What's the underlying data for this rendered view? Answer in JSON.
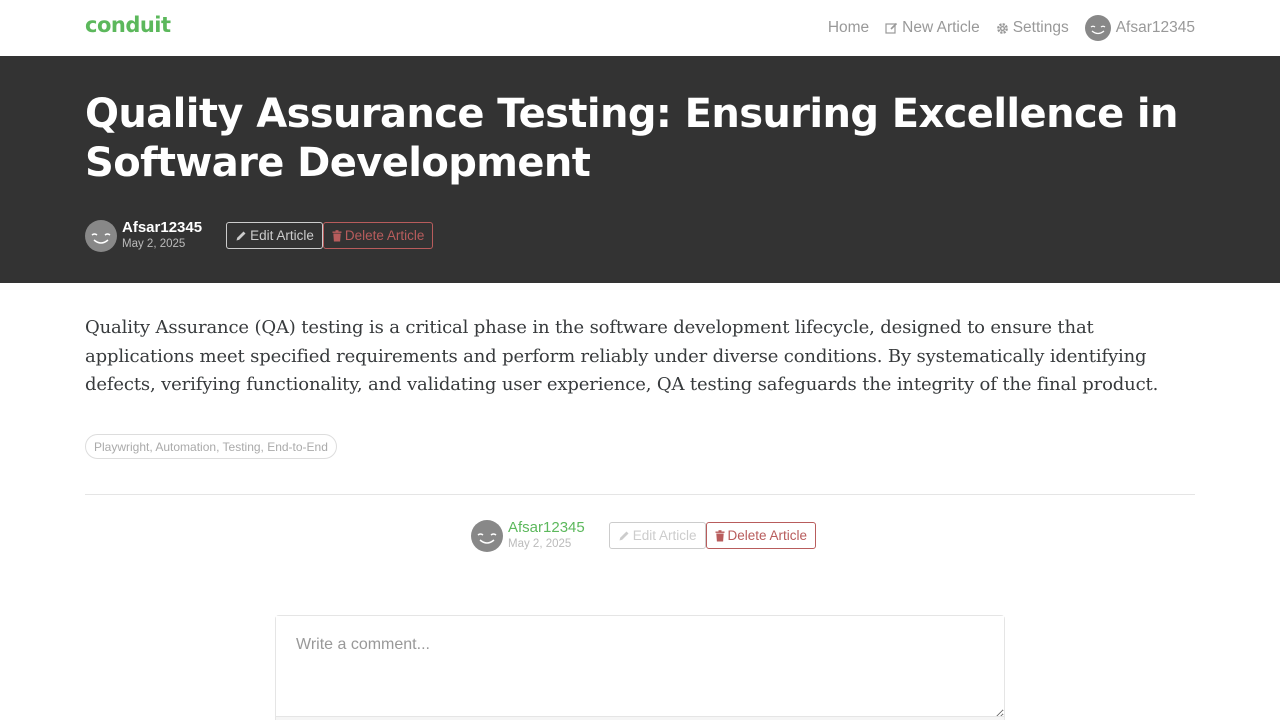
{
  "navbar": {
    "brand": "conduit",
    "items": [
      {
        "label": "Home",
        "icon": null
      },
      {
        "label": "New Article",
        "icon": "edit-icon"
      },
      {
        "label": "Settings",
        "icon": "gear-icon"
      },
      {
        "label": "Afsar12345",
        "icon": "avatar"
      }
    ]
  },
  "article": {
    "title": "Quality Assurance Testing: Ensuring Excellence in Software Development",
    "author": "Afsar12345",
    "date": "May 2, 2025",
    "body": "Quality Assurance (QA) testing is a critical phase in the software development lifecycle, designed to ensure that applications meet specified requirements and perform reliably under diverse conditions. By systematically identifying defects, verifying functionality, and validating user experience, QA testing safeguards the integrity of the final product.",
    "tags": "Playwright, Automation, Testing, End-to-End"
  },
  "actions": {
    "edit_label": "Edit Article",
    "delete_label": "Delete Article"
  },
  "comment": {
    "placeholder": "Write a comment..."
  },
  "colors": {
    "brand": "#5cb85c",
    "banner": "#333333",
    "danger": "#b85c5c"
  }
}
